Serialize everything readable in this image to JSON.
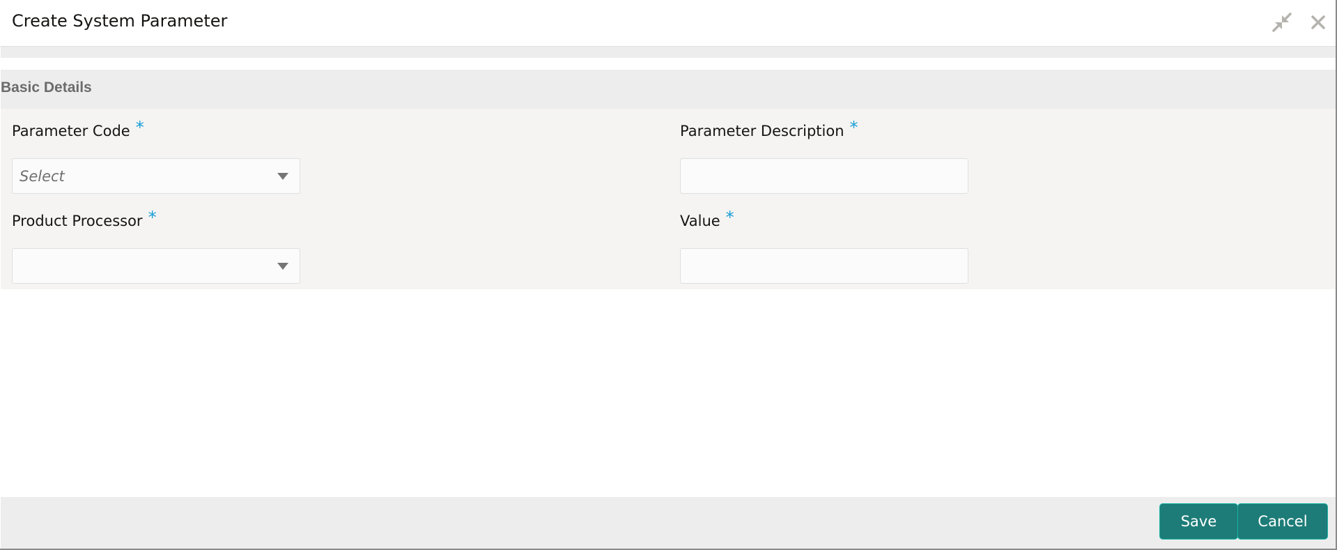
{
  "dialog": {
    "title": "Create System Parameter",
    "icons": {
      "minimize": "minimize-arrows-icon",
      "close": "close-icon"
    }
  },
  "section": {
    "title": "Basic Details"
  },
  "fields": {
    "parameter_code": {
      "label": "Parameter Code",
      "required_mark": "*",
      "type": "select",
      "placeholder": "Select",
      "value": ""
    },
    "parameter_description": {
      "label": "Parameter Description",
      "required_mark": "*",
      "type": "text",
      "value": ""
    },
    "product_processor": {
      "label": "Product Processor",
      "required_mark": "*",
      "type": "select",
      "value": ""
    },
    "value": {
      "label": "Value",
      "required_mark": "*",
      "type": "text",
      "value": ""
    }
  },
  "footer": {
    "save_label": "Save",
    "cancel_label": "Cancel"
  },
  "colors": {
    "accent": "#1d7c78",
    "required": "#1a9dd6",
    "section_bg": "#ededed",
    "form_bg": "#f5f4f2"
  }
}
